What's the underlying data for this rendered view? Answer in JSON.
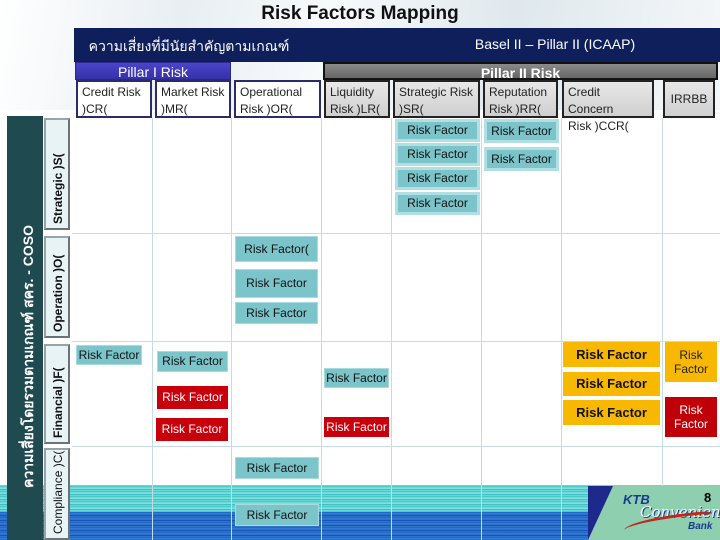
{
  "title": "Risk Factors  Mapping",
  "header": {
    "left_label": "ความเสี่ยงที่มีนัยสำคัญตามเกณฑ์",
    "right_label": "Basel II – Pillar II (ICAAP)"
  },
  "pillars": {
    "pillar1": "Pillar I Risk",
    "pillar2": "Pillar II Risk"
  },
  "columns": [
    {
      "line1": "Credit Risk",
      "line2": ")CR(",
      "group": "pillar1"
    },
    {
      "line1": "Market Risk",
      "line2": ")MR(",
      "group": "pillar1"
    },
    {
      "line1": "Operational",
      "line2": "Risk )OR(",
      "group": "pillar1"
    },
    {
      "line1": "Liquidity",
      "line2": "Risk )LR(",
      "group": "pillar2"
    },
    {
      "line1": "Strategic Risk",
      "line2": ")SR(",
      "group": "pillar2"
    },
    {
      "line1": "Reputation",
      "line2": "Risk )RR(",
      "group": "pillar2"
    },
    {
      "line1": "Credit Concern",
      "line2": "Risk )CCR(",
      "group": "pillar2"
    },
    {
      "line1": "IRRBB",
      "line2": "",
      "group": "pillar2"
    }
  ],
  "side_label": "ความเสี่ยงโดยรวมตามเกณฑ์   สคร. - COSO",
  "rows": [
    {
      "label": "Strategic )S("
    },
    {
      "label": "Operation )O("
    },
    {
      "label": "Financial )F("
    },
    {
      "label": "Compliance )C("
    }
  ],
  "risk_factor_label": "Risk Factor",
  "risk_factor_open_label": "Risk Factor(",
  "risk_factor_split": [
    "Risk",
    "Factor"
  ],
  "colors": {
    "teal": "#7bc4ca",
    "red": "#c8000b",
    "gold": "#f9b800",
    "header_navy": "#0e1f5c",
    "pillar1_blue": "#3630a8",
    "pillar2_gray": "#777777"
  },
  "logo": {
    "brand": "KTB",
    "script": "Convenience",
    "sub": "Bank"
  },
  "page_number": "8"
}
